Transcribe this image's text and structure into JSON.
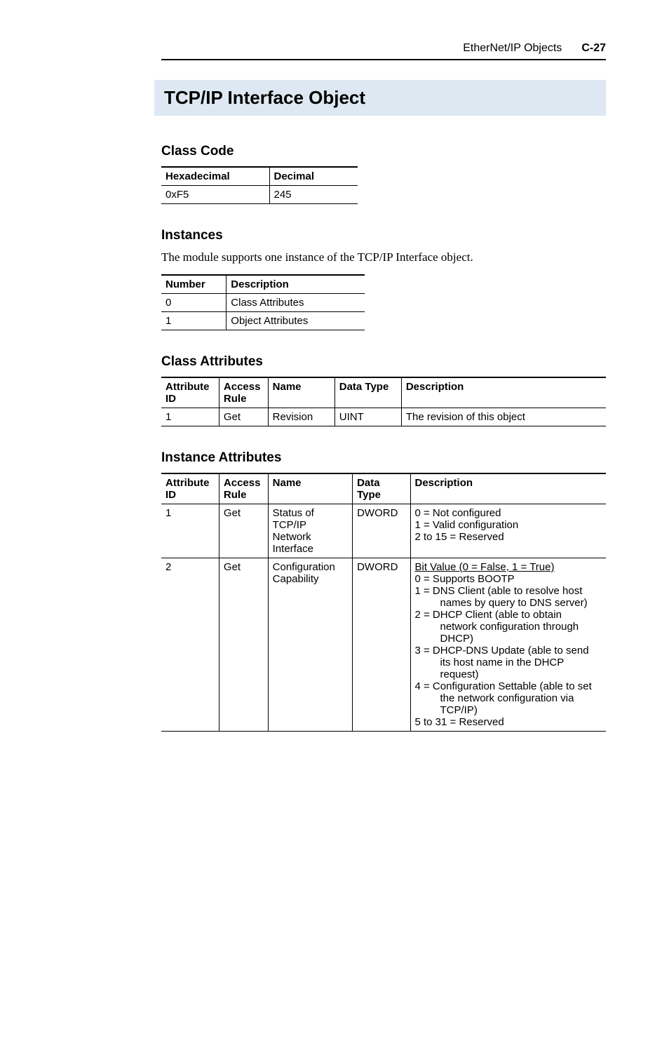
{
  "header": {
    "section": "EtherNet/IP Objects",
    "pagenum": "C-27"
  },
  "title": "TCP/IP Interface Object",
  "classCode": {
    "heading": "Class Code",
    "cols": [
      "Hexadecimal",
      "Decimal"
    ],
    "row": [
      "0xF5",
      "245"
    ]
  },
  "instances": {
    "heading": "Instances",
    "text": "The module supports one instance of the TCP/IP Interface object.",
    "cols": [
      "Number",
      "Description"
    ],
    "rows": [
      [
        "0",
        "Class Attributes"
      ],
      [
        "1",
        "Object Attributes"
      ]
    ]
  },
  "classAttrs": {
    "heading": "Class Attributes",
    "cols": [
      "Attribute ID",
      "Access Rule",
      "Name",
      "Data Type",
      "Description"
    ],
    "row": [
      "1",
      "Get",
      "Revision",
      "UINT",
      "The revision of this object"
    ]
  },
  "instAttrs": {
    "heading": "Instance Attributes",
    "cols": [
      "Attribute ID",
      "Access Rule",
      "Name",
      "Data Type",
      "Description"
    ],
    "rows": [
      {
        "id": "1",
        "rule": "Get",
        "name": "Status of TCP/IP Network Interface",
        "dtype": "DWORD",
        "desc": {
          "lines": [
            "0 = Not configured",
            "1 = Valid configuration",
            "2 to 15 = Reserved"
          ]
        }
      },
      {
        "id": "2",
        "rule": "Get",
        "name": "Configuration Capability",
        "dtype": "DWORD",
        "desc": {
          "header": "Bit  Value (0 = False, 1 = True)",
          "items": [
            {
              "lead": "0 = Supports BOOTP",
              "cont": ""
            },
            {
              "lead": "1 = DNS Client (able to resolve host",
              "cont": "names by query to DNS server)"
            },
            {
              "lead": "2 = DHCP Client (able to obtain",
              "cont": "network configuration through DHCP)"
            },
            {
              "lead": "3 = DHCP-DNS Update (able to send",
              "cont": "its host name in the DHCP request)"
            },
            {
              "lead": "4 = Configuration Settable (able to set",
              "cont": "the network configuration via TCP/IP)"
            },
            {
              "lead": "5 to 31 = Reserved",
              "cont": ""
            }
          ]
        }
      }
    ]
  }
}
